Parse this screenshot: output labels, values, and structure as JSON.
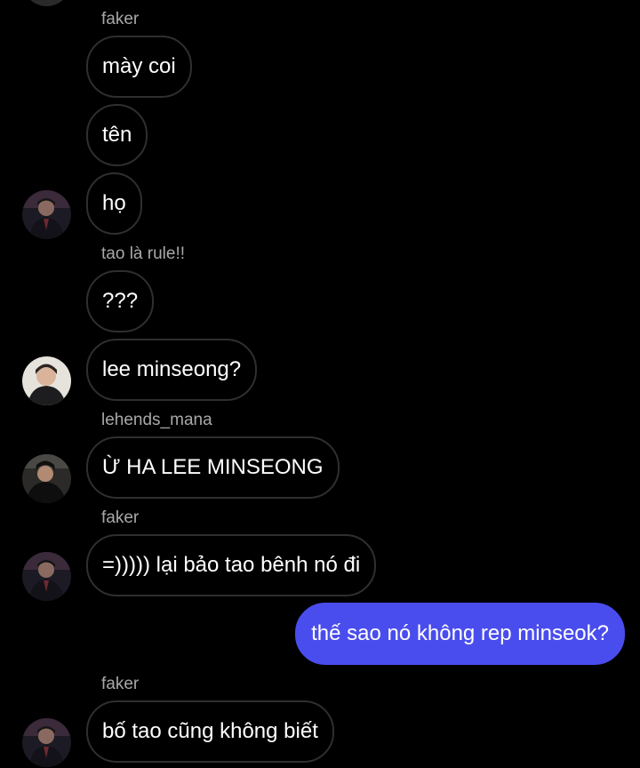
{
  "colors": {
    "background": "#000000",
    "incoming_bubble_border": "#2f2f2f",
    "outgoing_bubble": "#4a4ded",
    "sender_name": "#a8a8a8",
    "text": "#ffffff"
  },
  "messages": [
    {
      "sender": "faker"
    },
    {
      "text": "mày coi"
    },
    {
      "text": "tên"
    },
    {
      "text": "họ",
      "avatar": "faker-avatar"
    },
    {
      "sender": "tao là rule!!"
    },
    {
      "text": "???"
    },
    {
      "text": "lee minseong?",
      "avatar": "rule-avatar"
    },
    {
      "sender": "lehends_mana"
    },
    {
      "text": "Ừ HA LEE MINSEONG",
      "avatar": "lehends-avatar"
    },
    {
      "sender": "faker"
    },
    {
      "text": "=))))) lại bảo tao bênh nó đi",
      "avatar": "faker-avatar"
    },
    {
      "text": "thế sao nó không rep minseok?",
      "outgoing": true
    },
    {
      "sender": "faker"
    },
    {
      "text": "bố tao cũng không biết",
      "avatar": "faker-avatar"
    }
  ]
}
